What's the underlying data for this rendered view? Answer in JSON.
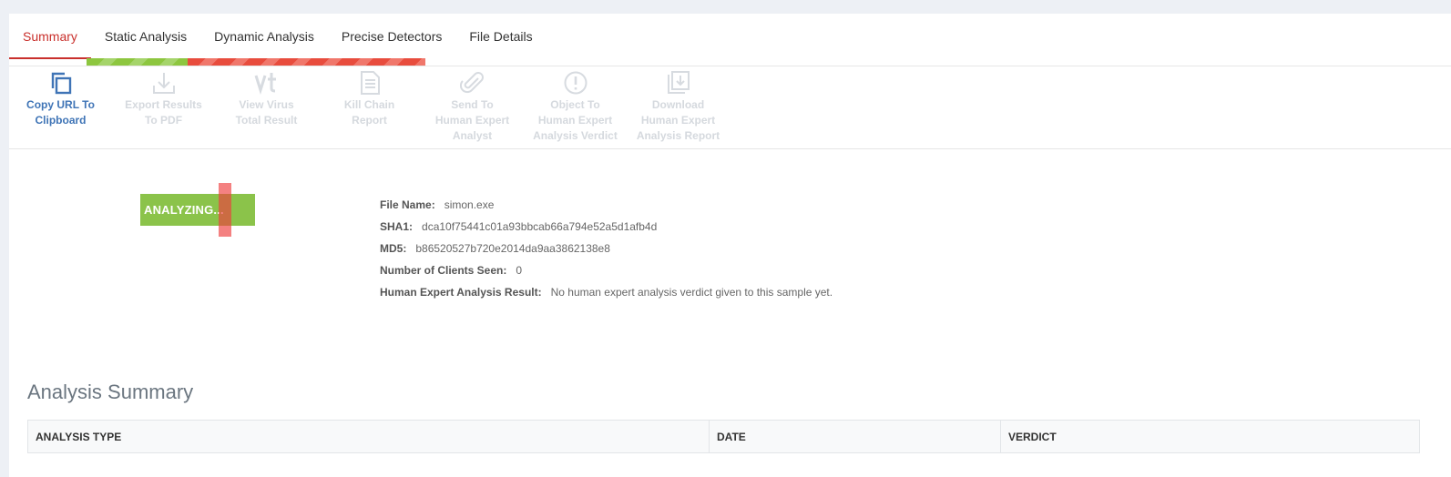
{
  "tabs": [
    {
      "label": "Summary"
    },
    {
      "label": "Static Analysis"
    },
    {
      "label": "Dynamic Analysis"
    },
    {
      "label": "Precise Detectors"
    },
    {
      "label": "File Details"
    }
  ],
  "toolbar": [
    {
      "line1": "Copy URL To",
      "line2": "Clipboard",
      "icon": "copy-icon"
    },
    {
      "line1": "Export Results",
      "line2": "To PDF",
      "icon": "download-icon"
    },
    {
      "line1": "View Virus",
      "line2": "Total Result",
      "icon": "vt-icon"
    },
    {
      "line1": "Kill Chain",
      "line2": "Report",
      "icon": "document-icon"
    },
    {
      "line1": "Send To",
      "line2": "Human Expert",
      "line3": "Analyst",
      "icon": "paperclip-icon"
    },
    {
      "line1": "Object To",
      "line2": "Human Expert",
      "line3": "Analysis Verdict",
      "icon": "exclamation-icon"
    },
    {
      "line1": "Download",
      "line2": "Human Expert",
      "line3": "Analysis Report",
      "icon": "report-download-icon"
    }
  ],
  "status": {
    "text": "ANALYZING..."
  },
  "file": {
    "name_label": "File Name:",
    "name": "simon.exe",
    "sha1_label": "SHA1:",
    "sha1": "dca10f75441c01a93bbcab66a794e52a5d1afb4d",
    "md5_label": "MD5:",
    "md5": "b86520527b720e2014da9aa3862138e8",
    "clients_label": "Number of Clients Seen:",
    "clients": "0",
    "hea_label": "Human Expert Analysis Result:",
    "hea": "No human expert analysis verdict given to this sample yet."
  },
  "summary": {
    "title": "Analysis Summary",
    "columns": [
      "ANALYSIS TYPE",
      "DATE",
      "VERDICT"
    ]
  },
  "colors": {
    "accent": "#c9302c",
    "link": "#3f74b6",
    "disabled": "#d5d9de",
    "analyzing": "#8bc34a",
    "bar_green": "#8dc63f",
    "bar_red": "#e84c3d"
  }
}
